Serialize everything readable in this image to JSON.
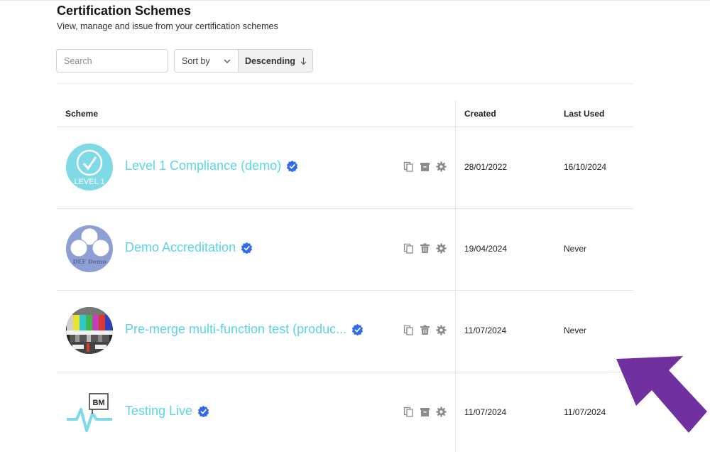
{
  "header": {
    "title": "Certification Schemes",
    "subtitle": "View, manage and issue from your certification schemes"
  },
  "controls": {
    "search_placeholder": "Search",
    "sort_label": "Sort by",
    "order_label": "Descending"
  },
  "table": {
    "columns": {
      "scheme": "Scheme",
      "created": "Created",
      "last_used": "Last Used"
    },
    "rows": [
      {
        "name": "Level 1 Compliance (demo)",
        "logo": "level-1-logo",
        "logo_text": "LEVEL 1",
        "created": "28/01/2022",
        "last_used": "16/10/2024",
        "verified": true
      },
      {
        "name": "Demo Accreditation",
        "logo": "def-demo-logo",
        "logo_text": "DEF Demo",
        "created": "19/04/2024",
        "last_used": "Never",
        "verified": true
      },
      {
        "name": "Pre-merge multi-function test (produc...",
        "logo": "test-card-logo",
        "created": "11/07/2024",
        "last_used": "Never",
        "verified": true
      },
      {
        "name": "Testing Live",
        "logo": "bm-logo",
        "logo_text": "BM",
        "created": "11/07/2024",
        "last_used": "11/07/2024",
        "verified": true
      }
    ]
  },
  "colors": {
    "link": "#5ad5e6",
    "verified": "#2f6bea",
    "annotation_arrow": "#7030a0"
  }
}
